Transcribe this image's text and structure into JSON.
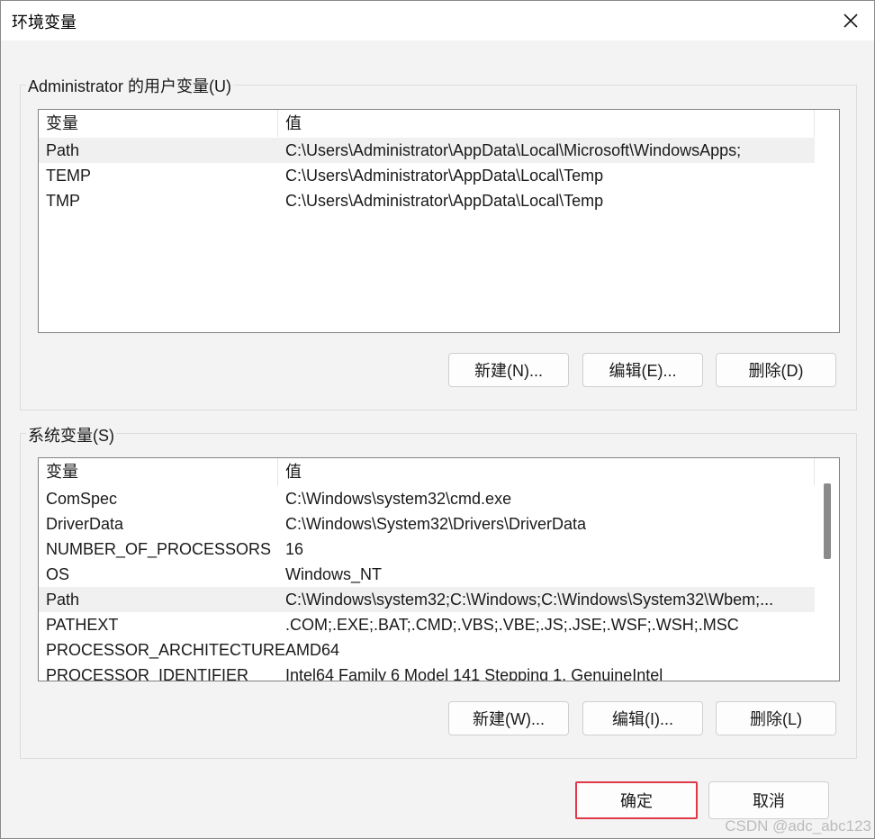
{
  "window": {
    "title": "环境变量",
    "close_icon": "close-icon"
  },
  "user_vars": {
    "group_label": "Administrator 的用户变量(U)",
    "columns": [
      "变量",
      "值"
    ],
    "rows": [
      {
        "name": "Path",
        "value": "C:\\Users\\Administrator\\AppData\\Local\\Microsoft\\WindowsApps;",
        "selected": true
      },
      {
        "name": "TEMP",
        "value": "C:\\Users\\Administrator\\AppData\\Local\\Temp",
        "selected": false
      },
      {
        "name": "TMP",
        "value": "C:\\Users\\Administrator\\AppData\\Local\\Temp",
        "selected": false
      }
    ],
    "buttons": {
      "new": "新建(N)...",
      "edit": "编辑(E)...",
      "delete": "删除(D)"
    }
  },
  "system_vars": {
    "group_label": "系统变量(S)",
    "columns": [
      "变量",
      "值"
    ],
    "rows": [
      {
        "name": "ComSpec",
        "value": "C:\\Windows\\system32\\cmd.exe",
        "selected": false
      },
      {
        "name": "DriverData",
        "value": "C:\\Windows\\System32\\Drivers\\DriverData",
        "selected": false
      },
      {
        "name": "NUMBER_OF_PROCESSORS",
        "value": "16",
        "selected": false
      },
      {
        "name": "OS",
        "value": "Windows_NT",
        "selected": false
      },
      {
        "name": "Path",
        "value": "C:\\Windows\\system32;C:\\Windows;C:\\Windows\\System32\\Wbem;...",
        "selected": true
      },
      {
        "name": "PATHEXT",
        "value": ".COM;.EXE;.BAT;.CMD;.VBS;.VBE;.JS;.JSE;.WSF;.WSH;.MSC",
        "selected": false
      },
      {
        "name": "PROCESSOR_ARCHITECTURE",
        "value": "AMD64",
        "selected": false
      },
      {
        "name": "PROCESSOR_IDENTIFIER",
        "value": "Intel64 Family 6 Model 141 Stepping 1, GenuineIntel",
        "selected": false
      }
    ],
    "buttons": {
      "new": "新建(W)...",
      "edit": "编辑(I)...",
      "delete": "删除(L)"
    }
  },
  "footer": {
    "ok": "确定",
    "cancel": "取消",
    "ok_highlight_color": "#e0394a"
  },
  "watermark": "CSDN @adc_abc123"
}
